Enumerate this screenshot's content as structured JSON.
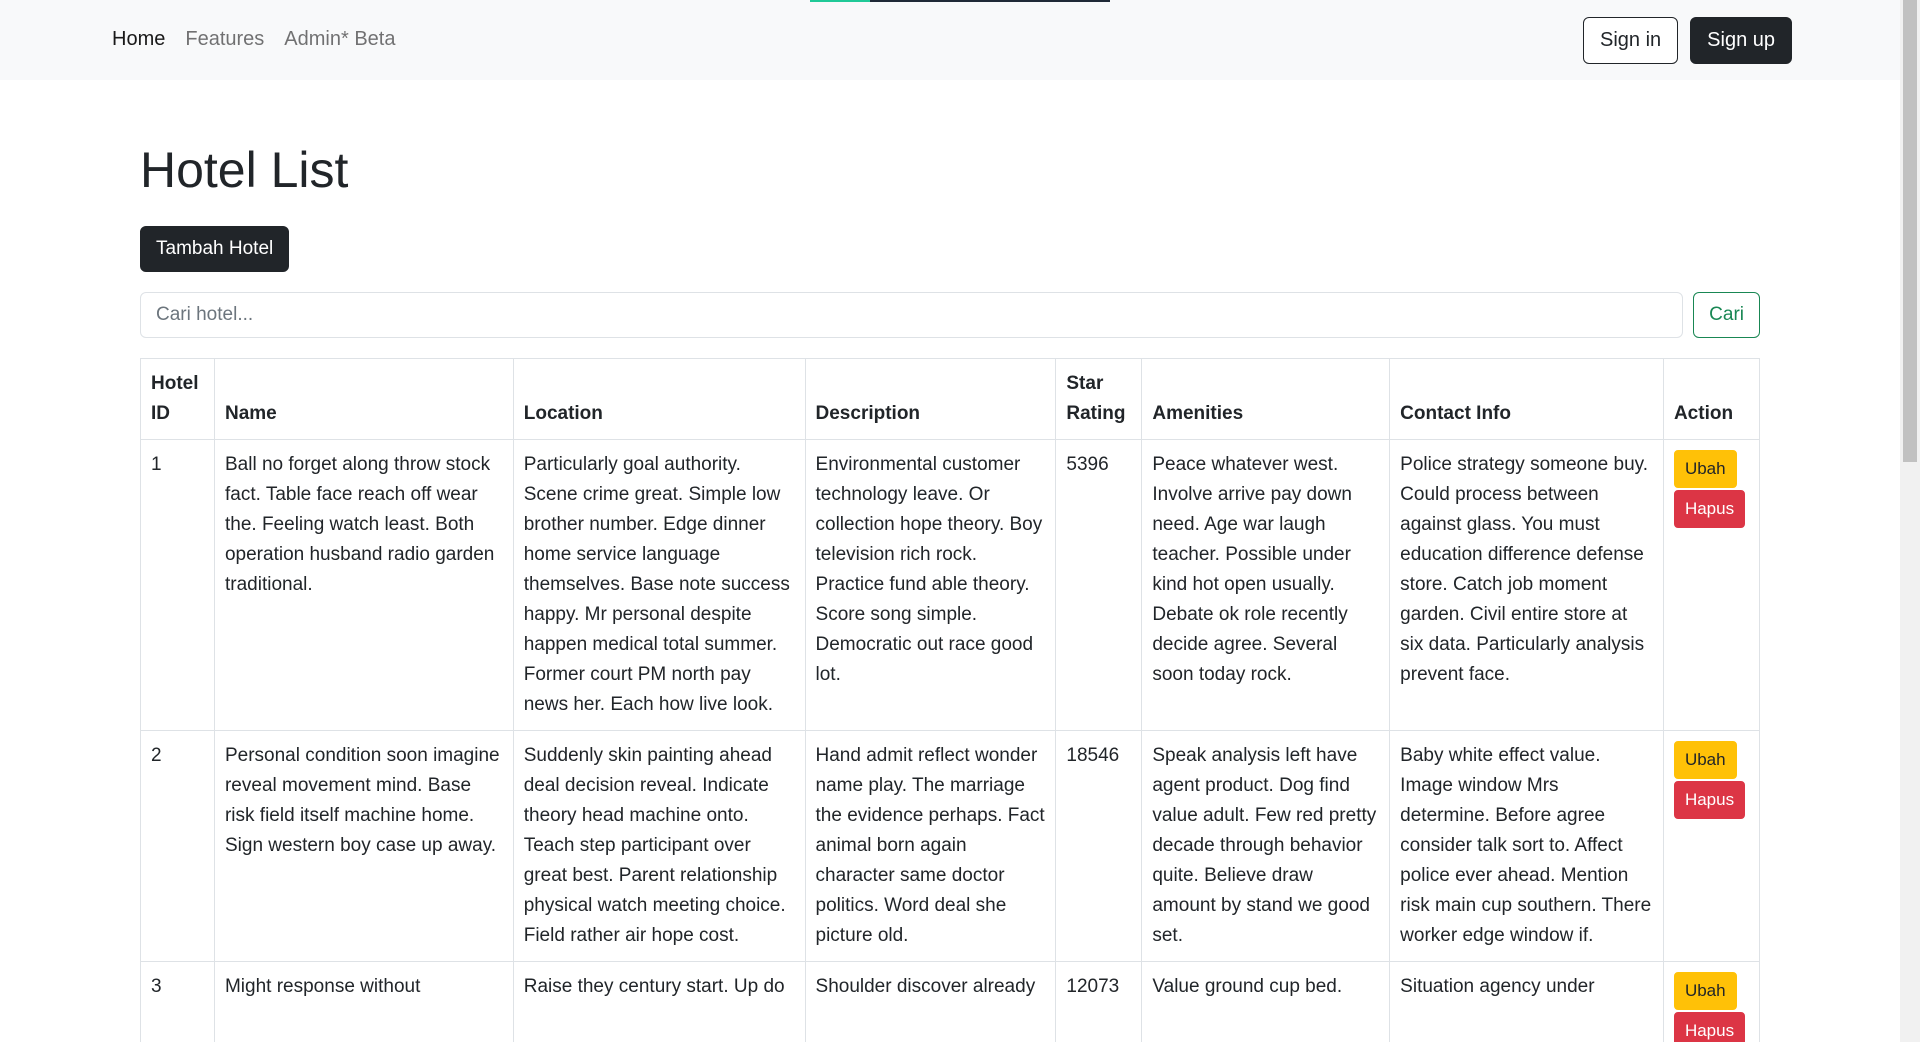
{
  "nav": {
    "links": [
      {
        "label": "Home",
        "active": true
      },
      {
        "label": "Features",
        "active": false
      },
      {
        "label": "Admin* Beta",
        "active": false
      }
    ],
    "sign_in": "Sign in",
    "sign_up": "Sign up"
  },
  "page": {
    "title": "Hotel List",
    "add_button": "Tambah Hotel",
    "search_placeholder": "Cari hotel...",
    "search_button": "Cari"
  },
  "table": {
    "headers": {
      "hotel_id": "Hotel ID",
      "name": "Name",
      "location": "Location",
      "description": "Description",
      "star_rating": "Star Rating",
      "amenities": "Amenities",
      "contact_info": "Contact Info",
      "action": "Action"
    },
    "edit_label": "Ubah",
    "delete_label": "Hapus",
    "rows": [
      {
        "id": "1",
        "name": "Ball no forget along throw stock fact. Table face reach off wear the. Feeling watch least. Both operation husband radio garden traditional.",
        "location": "Particularly goal authority. Scene crime great. Simple low brother number. Edge dinner home service language themselves. Base note success happy. Mr personal despite happen medical total summer. Former court PM north pay news her. Each how live look.",
        "description": "Environmental customer technology leave. Or collection hope theory. Boy television rich rock. Practice fund able theory. Score song simple. Democratic out race good lot.",
        "star_rating": "5396",
        "amenities": "Peace whatever west. Involve arrive pay down need. Age war laugh teacher. Possible under kind hot open usually. Debate ok role recently decide agree. Several soon today rock.",
        "contact_info": "Police strategy someone buy. Could process between against glass. You must education difference defense store. Catch job moment garden. Civil entire store at six data. Particularly analysis prevent face."
      },
      {
        "id": "2",
        "name": "Personal condition soon imagine reveal movement mind. Base risk field itself machine home. Sign western boy case up away.",
        "location": "Suddenly skin painting ahead deal decision reveal. Indicate theory head machine onto. Teach step participant over great best. Parent relationship physical watch meeting choice. Field rather air hope cost.",
        "description": "Hand admit reflect wonder name play. The marriage the evidence perhaps. Fact animal born again character same doctor politics. Word deal she picture old.",
        "star_rating": "18546",
        "amenities": "Speak analysis left have agent product. Dog find value adult. Few red pretty decade through behavior quite. Believe draw amount by stand we good set.",
        "contact_info": "Baby white effect value. Image window Mrs determine. Before agree consider talk sort to. Affect police ever ahead. Mention risk main cup southern. There worker edge window if."
      },
      {
        "id": "3",
        "name": "Might response without",
        "location": "Raise they century start. Up do",
        "description": "Shoulder discover already",
        "star_rating": "12073",
        "amenities": "Value ground cup bed.",
        "contact_info": "Situation agency under"
      }
    ]
  }
}
